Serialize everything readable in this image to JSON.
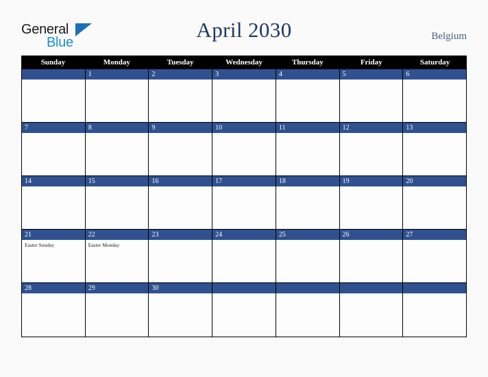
{
  "brand": {
    "logo_line1": "General",
    "logo_line2": "Blue",
    "logo_accent_color": "#1b8fd4"
  },
  "header": {
    "title": "April 2030",
    "location": "Belgium",
    "title_color": "#1f3864",
    "location_color": "#495f87"
  },
  "calendar": {
    "month": "April",
    "year": "2030",
    "week_start": "Sunday",
    "header_bg": "#000000",
    "date_bar_color": "#2f5190",
    "cell_bg": "#fdfdfd",
    "day_names": [
      "Sunday",
      "Monday",
      "Tuesday",
      "Wednesday",
      "Thursday",
      "Friday",
      "Saturday"
    ],
    "weeks": [
      [
        {
          "date": "",
          "events": []
        },
        {
          "date": "1",
          "events": []
        },
        {
          "date": "2",
          "events": []
        },
        {
          "date": "3",
          "events": []
        },
        {
          "date": "4",
          "events": []
        },
        {
          "date": "5",
          "events": []
        },
        {
          "date": "6",
          "events": []
        }
      ],
      [
        {
          "date": "7",
          "events": []
        },
        {
          "date": "8",
          "events": []
        },
        {
          "date": "9",
          "events": []
        },
        {
          "date": "10",
          "events": []
        },
        {
          "date": "11",
          "events": []
        },
        {
          "date": "12",
          "events": []
        },
        {
          "date": "13",
          "events": []
        }
      ],
      [
        {
          "date": "14",
          "events": []
        },
        {
          "date": "15",
          "events": []
        },
        {
          "date": "16",
          "events": []
        },
        {
          "date": "17",
          "events": []
        },
        {
          "date": "18",
          "events": []
        },
        {
          "date": "19",
          "events": []
        },
        {
          "date": "20",
          "events": []
        }
      ],
      [
        {
          "date": "21",
          "events": [
            "Easter Sunday"
          ]
        },
        {
          "date": "22",
          "events": [
            "Easter Monday"
          ]
        },
        {
          "date": "23",
          "events": []
        },
        {
          "date": "24",
          "events": []
        },
        {
          "date": "25",
          "events": []
        },
        {
          "date": "26",
          "events": []
        },
        {
          "date": "27",
          "events": []
        }
      ],
      [
        {
          "date": "28",
          "events": []
        },
        {
          "date": "29",
          "events": []
        },
        {
          "date": "30",
          "events": []
        },
        {
          "date": "",
          "events": []
        },
        {
          "date": "",
          "events": []
        },
        {
          "date": "",
          "events": []
        },
        {
          "date": "",
          "events": []
        }
      ]
    ]
  }
}
